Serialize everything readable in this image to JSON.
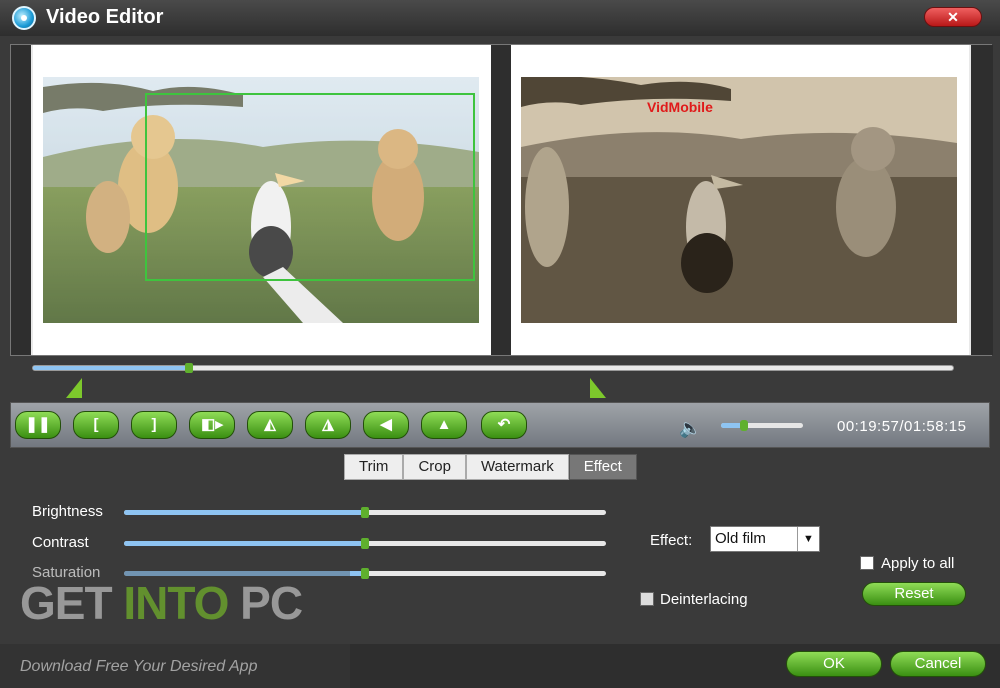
{
  "window": {
    "title": "Video Editor",
    "close_label": "✕"
  },
  "preview": {
    "watermark_text": "VidMobile"
  },
  "timeline": {
    "progress": 0.17
  },
  "controls": {
    "buttons": [
      {
        "name": "pause-button",
        "glyph": "❚❚"
      },
      {
        "name": "mark-in-button",
        "glyph": "["
      },
      {
        "name": "mark-out-button",
        "glyph": "]"
      },
      {
        "name": "split-button",
        "glyph": "◧▸"
      },
      {
        "name": "flip-horizontal-button",
        "glyph": "◭"
      },
      {
        "name": "flip-vertical-button",
        "glyph": "◮"
      },
      {
        "name": "rotate-left-button",
        "glyph": "◀"
      },
      {
        "name": "rotate-right-button",
        "glyph": "▲"
      },
      {
        "name": "undo-button",
        "glyph": "↶"
      }
    ],
    "volume_icon": "speaker-icon",
    "volume_level": 0.28,
    "timecode": "00:19:57/01:58:15"
  },
  "tabs": [
    {
      "label": "Trim",
      "active": false
    },
    {
      "label": "Crop",
      "active": false
    },
    {
      "label": "Watermark",
      "active": false
    },
    {
      "label": "Effect",
      "active": true
    }
  ],
  "adjustments": [
    {
      "label": "Brightness",
      "value": 0.5
    },
    {
      "label": "Contrast",
      "value": 0.5
    },
    {
      "label": "Saturation",
      "value": 0.5
    }
  ],
  "effect": {
    "label": "Effect:",
    "value": "Old film"
  },
  "apply_to_all": {
    "label": "Apply to all",
    "checked": false
  },
  "deinterlacing": {
    "label": "Deinterlacing",
    "checked": false
  },
  "reset_label": "Reset",
  "ok_label": "OK",
  "cancel_label": "Cancel",
  "site_watermark": {
    "get": "GET ",
    "into": "INTO",
    "pc": " PC",
    "tagline": "Download Free Your Desired App"
  },
  "colors": {
    "accent_green": "#5fb02d",
    "slider_fill": "#8ec4f2",
    "crop_box": "#3ec43e",
    "watermark_red": "#e01a1a"
  }
}
